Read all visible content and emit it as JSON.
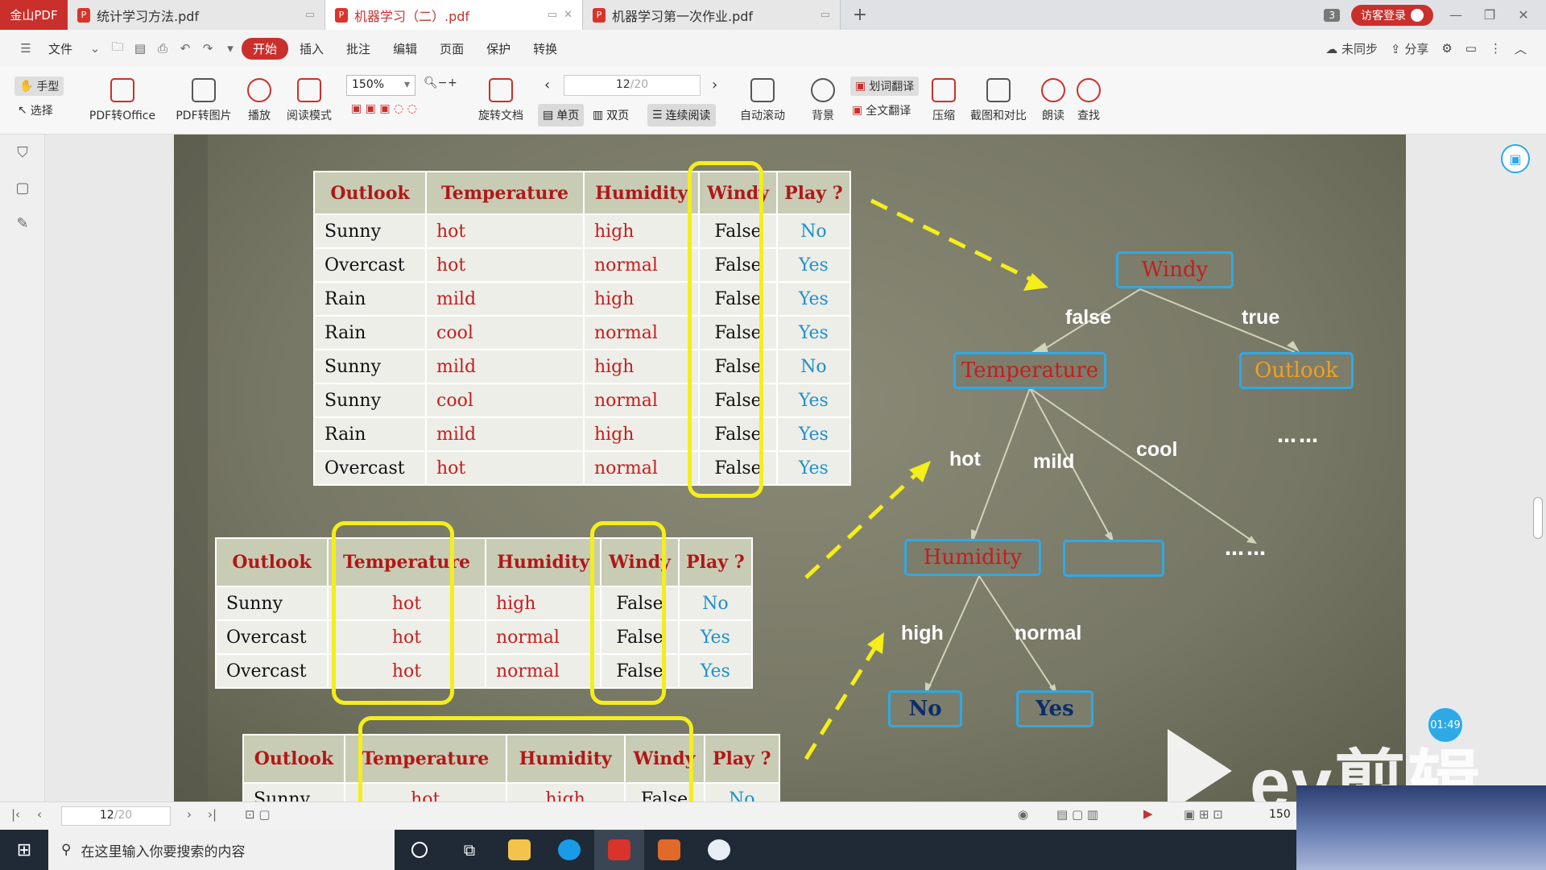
{
  "tabbar": {
    "brand": "金山PDF",
    "tabs": [
      {
        "label": "统计学习方法.pdf"
      },
      {
        "label": "机器学习（二）.pdf"
      },
      {
        "label": "机器学习第一次作业.pdf"
      }
    ],
    "plus": "+",
    "count": "3",
    "login": "访客登录"
  },
  "menubar": {
    "file": "文件",
    "items": [
      "开始",
      "插入",
      "批注",
      "编辑",
      "页面",
      "保护",
      "转换"
    ],
    "sync": "未同步",
    "share": "分享"
  },
  "toolbar": {
    "hand": "手型",
    "select": "选择",
    "pdf_to_office": "PDF转Office",
    "pdf_to_image": "PDF转图片",
    "play": "播放",
    "read_mode": "阅读模式",
    "zoom": "150%",
    "rotate": "旋转文档",
    "page": "12",
    "page_total": "/20",
    "single": "单页",
    "double": "双页",
    "continuous": "连续阅读",
    "autoscroll": "自动滚动",
    "background": "背景",
    "word_translate": "划词翻译",
    "full_translate": "全文翻译",
    "compress": "压缩",
    "screenshot": "截图和对比",
    "read_aloud": "朗读",
    "find": "查找"
  },
  "slide": {
    "headers": [
      "Outlook",
      "Temperature",
      "Humidity",
      "Windy",
      "Play ?"
    ],
    "table1": [
      [
        "Sunny",
        "hot",
        "high",
        "False",
        "No"
      ],
      [
        "Overcast",
        "hot",
        "normal",
        "False",
        "Yes"
      ],
      [
        "Rain",
        "mild",
        "high",
        "False",
        "Yes"
      ],
      [
        "Rain",
        "cool",
        "normal",
        "False",
        "Yes"
      ],
      [
        "Sunny",
        "mild",
        "high",
        "False",
        "No"
      ],
      [
        "Sunny",
        "cool",
        "normal",
        "False",
        "Yes"
      ],
      [
        "Rain",
        "mild",
        "high",
        "False",
        "Yes"
      ],
      [
        "Overcast",
        "hot",
        "normal",
        "False",
        "Yes"
      ]
    ],
    "table2": [
      [
        "Sunny",
        "hot",
        "high",
        "False",
        "No"
      ],
      [
        "Overcast",
        "hot",
        "normal",
        "False",
        "Yes"
      ],
      [
        "Overcast",
        "hot",
        "normal",
        "False",
        "Yes"
      ]
    ],
    "tree": {
      "root": "Windy",
      "edge_false": "false",
      "edge_true": "true",
      "temperature": "Temperature",
      "outlook": "Outlook",
      "edge_hot": "hot",
      "edge_mild": "mild",
      "edge_cool": "cool",
      "humidity": "Humidity",
      "edge_high": "high",
      "edge_normal": "normal",
      "leaf_no": "No",
      "leaf_yes": "Yes",
      "dots1": "……",
      "dots2": "……"
    }
  },
  "bottombar": {
    "page": "12",
    "page_total": "/20",
    "zoom": "150"
  },
  "overlay": {
    "timer": "01:49",
    "watermark": "ev剪辑"
  },
  "taskbar": {
    "search_placeholder": "在这里输入你要搜索的内容"
  },
  "colors": {
    "accent": "#c9302c",
    "highlight": "#f4ee1a",
    "node_border": "#2ea9e6"
  }
}
